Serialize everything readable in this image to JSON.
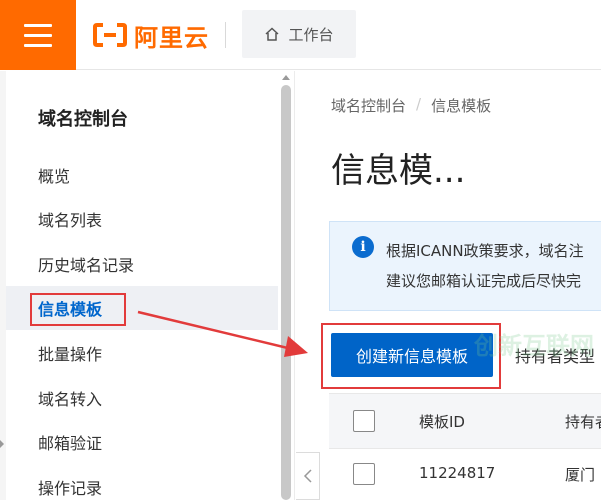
{
  "header": {
    "logo_text": "阿里云",
    "workbench_label": "工作台"
  },
  "sidebar": {
    "title": "域名控制台",
    "items": [
      {
        "label": "概览"
      },
      {
        "label": "域名列表"
      },
      {
        "label": "历史域名记录"
      },
      {
        "label": "信息模板"
      },
      {
        "label": "批量操作"
      },
      {
        "label": "域名转入"
      },
      {
        "label": "邮箱验证"
      },
      {
        "label": "操作记录"
      }
    ]
  },
  "main": {
    "breadcrumb": [
      "域名控制台",
      "信息模板"
    ],
    "breadcrumb_separator": "/",
    "page_title": "信息模...",
    "notice": {
      "line1": "根据ICANN政策要求，域名注",
      "line2": "建议您邮箱认证完成后尽快完"
    },
    "create_button_label": "创建新信息模板",
    "holder_type_label": "持有者类型",
    "table": {
      "columns": [
        "模板ID",
        "持有者"
      ],
      "rows": [
        {
          "template_id": "11224817",
          "holder": "厦门"
        }
      ]
    }
  },
  "watermark_text": "创新互联网",
  "colors": {
    "brand_orange": "#ff6a00",
    "primary_blue": "#0064c8",
    "annotation_red": "#e23b3b",
    "notice_bg": "#ebf4fd"
  }
}
